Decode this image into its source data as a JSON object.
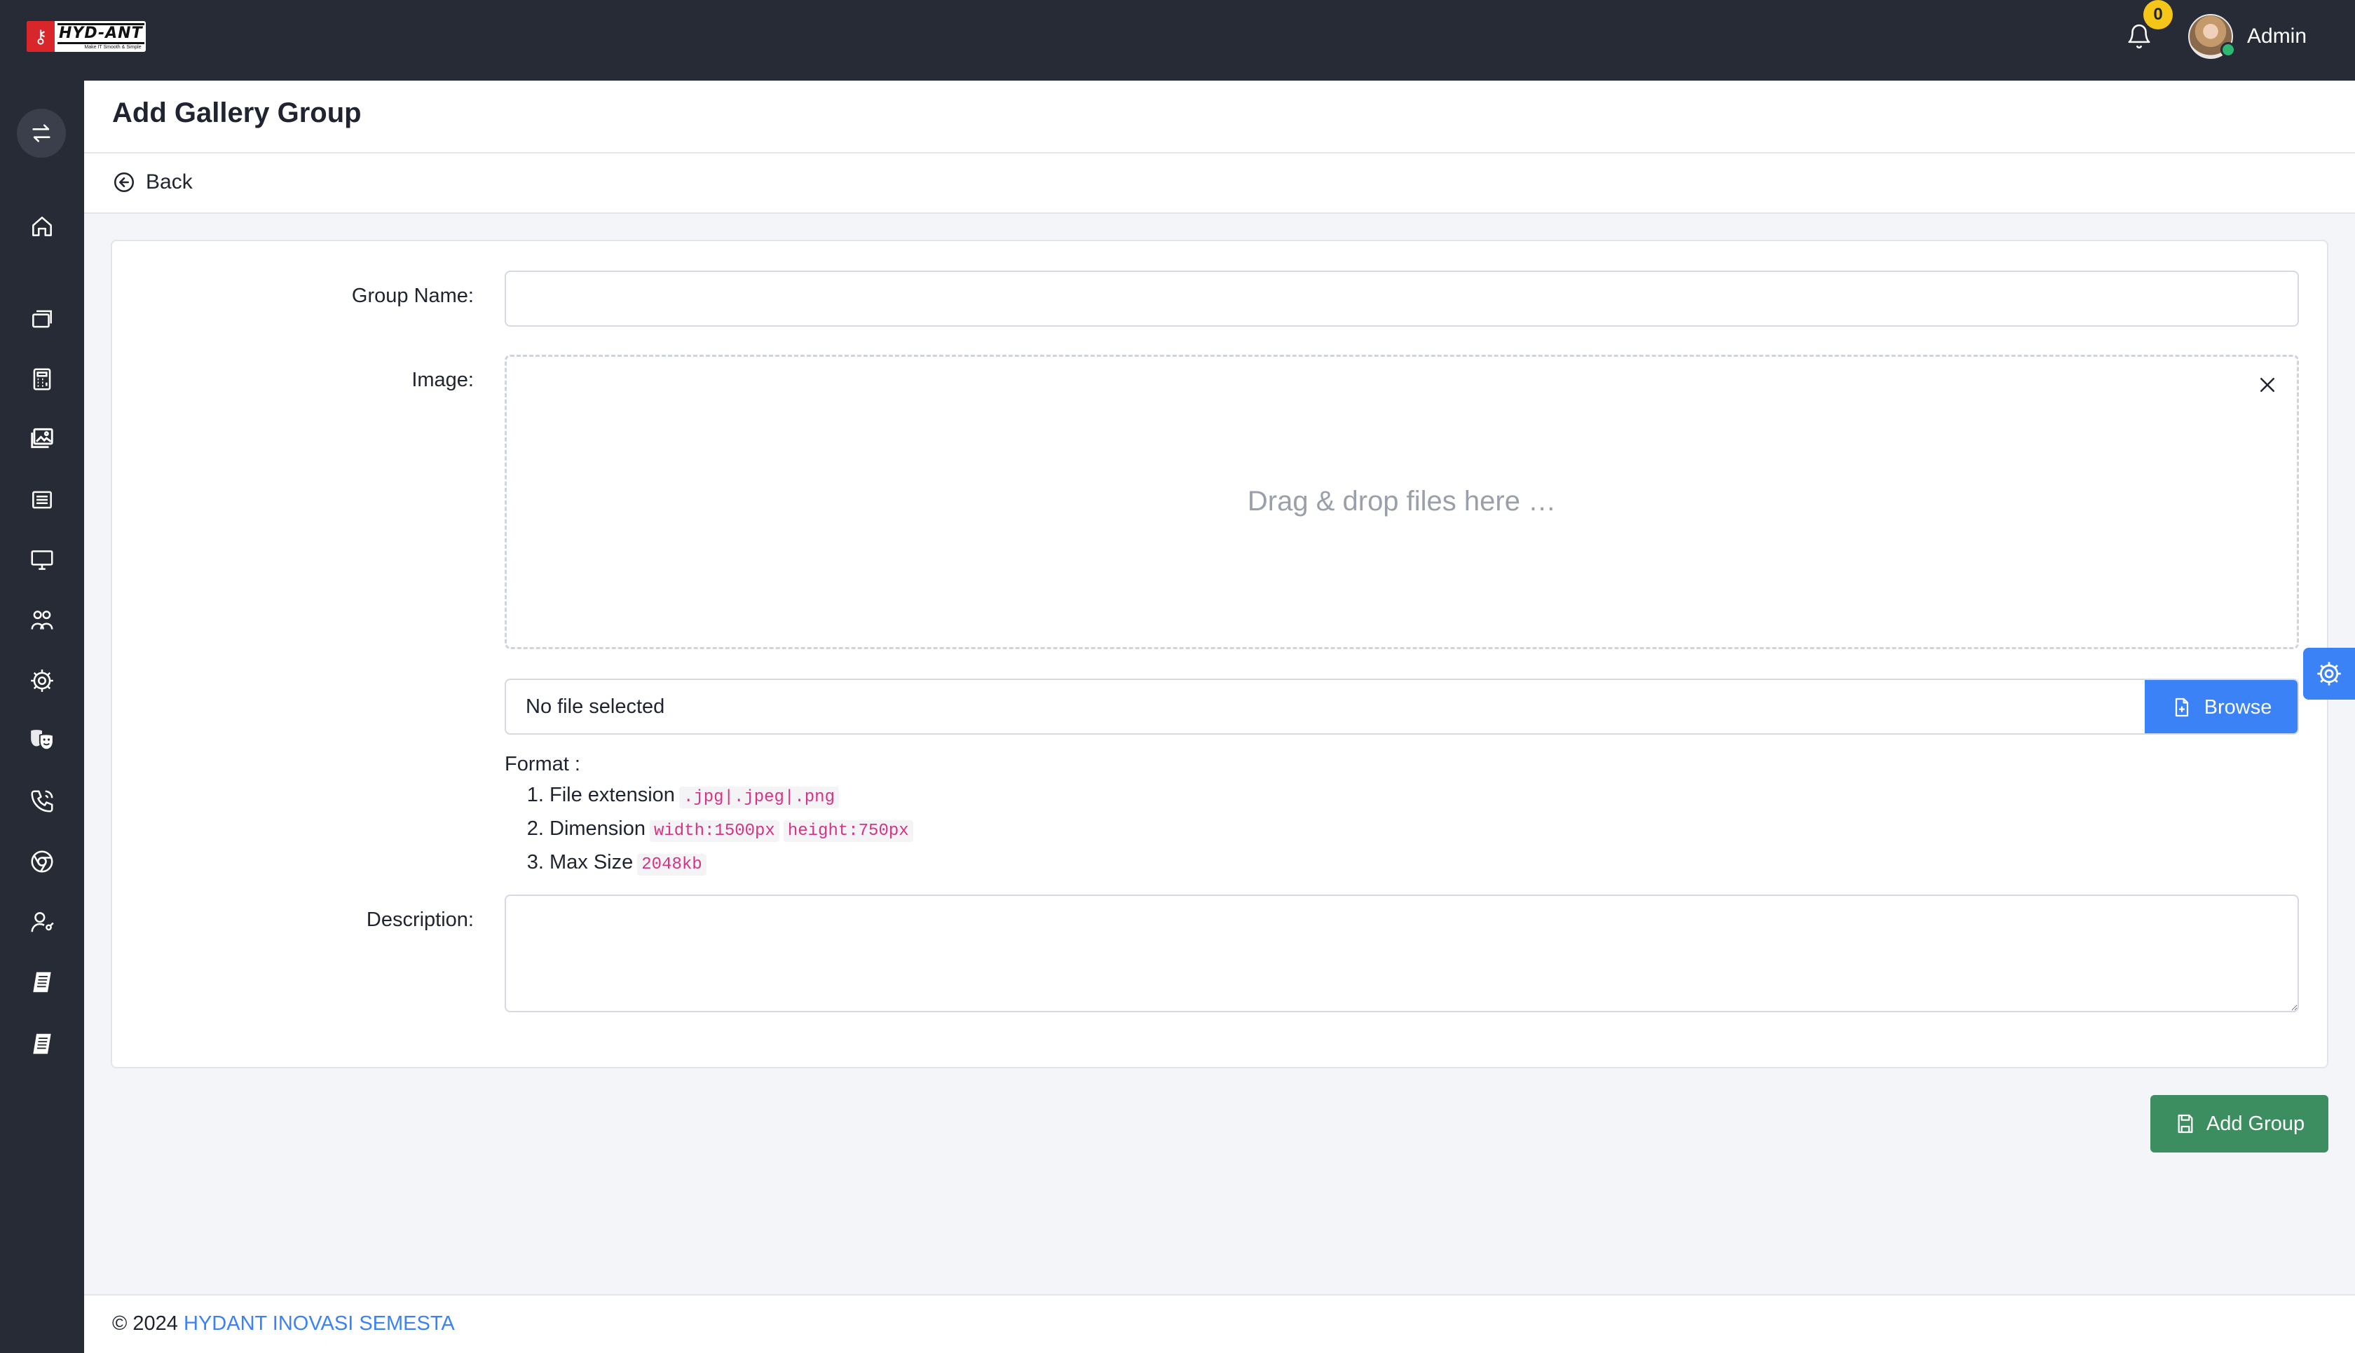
{
  "brand": {
    "logo_text": "HYD-ANT",
    "logo_tagline": "Make IT Smooth & Simple"
  },
  "topbar": {
    "notification_count": "0",
    "user_name": "Admin"
  },
  "sidebar": {
    "items": [
      {
        "icon": "home-icon"
      },
      {
        "icon": "stack-icon"
      },
      {
        "icon": "calculator-icon"
      },
      {
        "icon": "gallery-icon"
      },
      {
        "icon": "list-icon"
      },
      {
        "icon": "monitor-icon"
      },
      {
        "icon": "users-group-icon"
      },
      {
        "icon": "gear-icon"
      },
      {
        "icon": "theater-masks-icon"
      },
      {
        "icon": "phone-call-icon"
      },
      {
        "icon": "chrome-icon"
      },
      {
        "icon": "user-key-icon"
      },
      {
        "icon": "document-icon"
      },
      {
        "icon": "document-icon"
      }
    ]
  },
  "page": {
    "title": "Add Gallery Group",
    "back_label": "Back"
  },
  "form": {
    "group_name_label": "Group Name:",
    "group_name_value": "",
    "image_label": "Image:",
    "dropzone_text": "Drag & drop files here …",
    "file_status": "No file selected",
    "browse_label": "Browse",
    "format_title": "Format :",
    "format_items": [
      {
        "text": "File extension",
        "codes": [
          ".jpg|.jpeg|.png"
        ]
      },
      {
        "text": "Dimension",
        "codes": [
          "width:1500px",
          "height:750px"
        ]
      },
      {
        "text": "Max Size",
        "codes": [
          "2048kb"
        ]
      }
    ],
    "description_label": "Description:",
    "description_value": "",
    "submit_label": "Add Group"
  },
  "footer": {
    "copyright": "© 2024",
    "company": "HYDANT INOVASI SEMESTA"
  },
  "colors": {
    "topbar_bg": "#272b35",
    "primary": "#3b82f6",
    "success": "#3c8d5f",
    "badge": "#f5c518",
    "code": "#d63384"
  }
}
